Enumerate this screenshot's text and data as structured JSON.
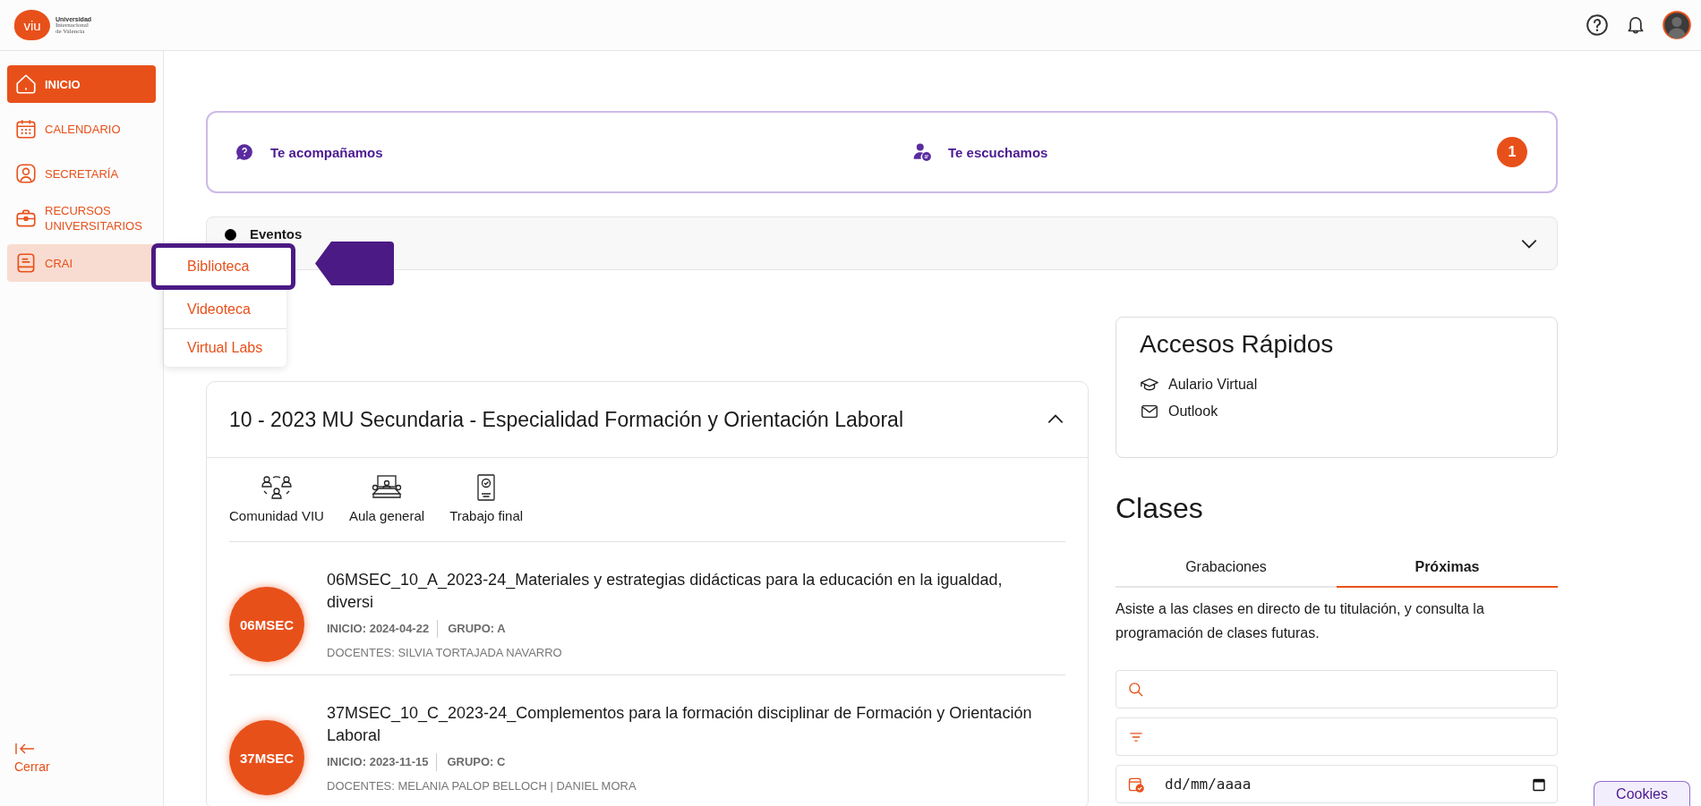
{
  "header": {
    "logo_mark": "viu",
    "logo_lines": [
      "Universidad",
      "Internacional",
      "de Valencia"
    ]
  },
  "sidebar": {
    "items": [
      {
        "label": "INICIO",
        "selected": true,
        "expanded": false
      },
      {
        "label": "CALENDARIO",
        "selected": false,
        "expanded": false
      },
      {
        "label": "SECRETARÍA",
        "selected": false,
        "expanded": false
      },
      {
        "label": "RECURSOS UNIVERSITARIOS",
        "selected": false,
        "expanded": false
      },
      {
        "label": "CRAI",
        "selected": false,
        "expanded": true
      }
    ],
    "collapse_label": "Cerrar"
  },
  "crai_menu": {
    "items": [
      {
        "label": "Biblioteca",
        "selected": true
      },
      {
        "label": "Videoteca",
        "selected": false
      },
      {
        "label": "Virtual Labs",
        "selected": false
      }
    ]
  },
  "support_banner": {
    "items": [
      "Te acompañamos",
      "Te escuchamos"
    ],
    "badge": "1"
  },
  "events": {
    "title": "Eventos",
    "expanded": false
  },
  "course": {
    "title": "10 - 2023 MU Secundaria - Especialidad Formación y Orientación Laboral",
    "expanded": true,
    "shortcuts": [
      "Comunidad VIU",
      "Aula general",
      "Trabajo final"
    ],
    "subjects": [
      {
        "code": "06MSEC",
        "title": "06MSEC_10_A_2023-24_Materiales y estrategias didácticas para la educación en la igualdad, diversi",
        "start": "INICIO: 2024-04-22",
        "group": "GRUPO: A",
        "teachers": "DOCENTES: SILVIA TORTAJADA NAVARRO"
      },
      {
        "code": "37MSEC",
        "title": "37MSEC_10_C_2023-24_Complementos para la formación disciplinar de Formación y Orientación Laboral",
        "start": "INICIO: 2023-11-15",
        "group": "GRUPO: C",
        "teachers": "DOCENTES: MELANIA PALOP BELLOCH | DANIEL MORA"
      }
    ]
  },
  "quick_access": {
    "title": "Accesos Rápidos",
    "links": [
      "Aulario Virtual",
      "Outlook"
    ]
  },
  "classes": {
    "title": "Clases",
    "tabs": [
      {
        "label": "Grabaciones",
        "selected": false
      },
      {
        "label": "Próximas",
        "selected": true
      }
    ],
    "description": "Asiste a las clases en directo de tu titulación, y consulta la programación de clases futuras.",
    "date_placeholder": "dd/mm/aaaa"
  },
  "cookies": "Cookies"
}
